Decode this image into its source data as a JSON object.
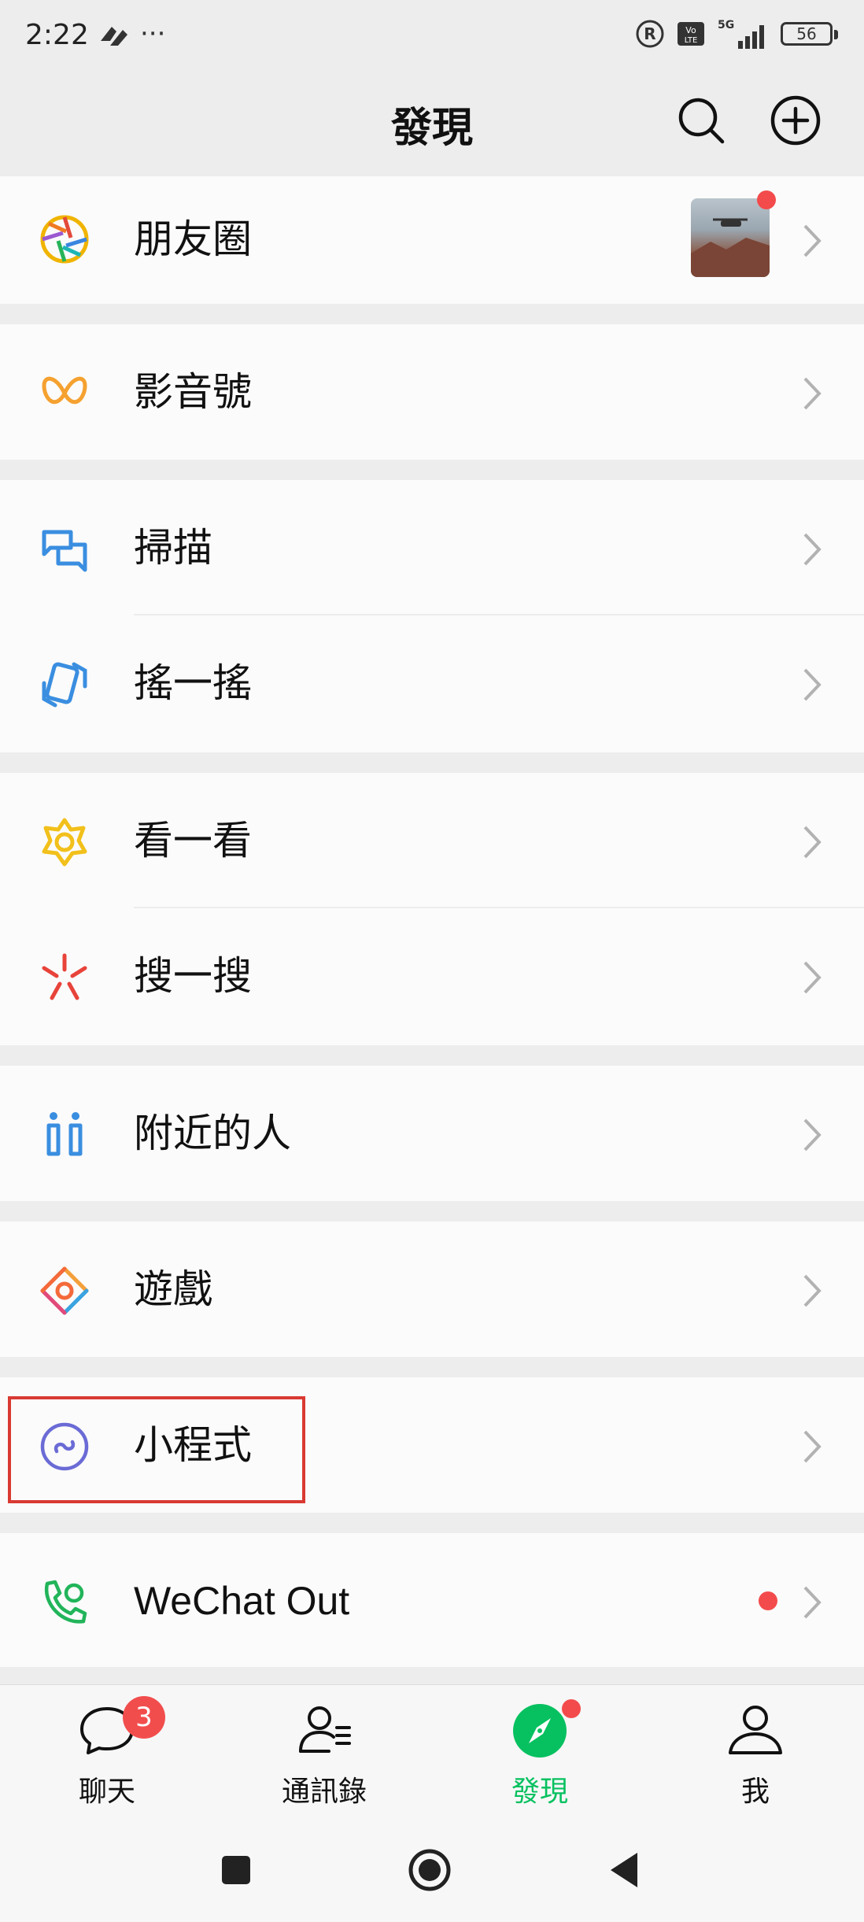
{
  "status_bar": {
    "time": "2:22",
    "more": "···",
    "network": "5G",
    "battery": "56"
  },
  "header": {
    "title": "發現"
  },
  "menu": {
    "moments": "朋友圈",
    "channels": "影音號",
    "scan": "掃描",
    "shake": "搖一搖",
    "top_stories": "看一看",
    "search": "搜一搜",
    "nearby": "附近的人",
    "games": "遊戲",
    "mini_programs": "小程式",
    "wechat_out": "WeChat Out"
  },
  "tabbar": {
    "chats": "聊天",
    "chats_badge": "3",
    "contacts": "通訊錄",
    "discover": "發現",
    "me": "我"
  },
  "colors": {
    "accent_green": "#07c160",
    "badge_red": "#f24d4d",
    "highlight_red": "#d93a33"
  }
}
